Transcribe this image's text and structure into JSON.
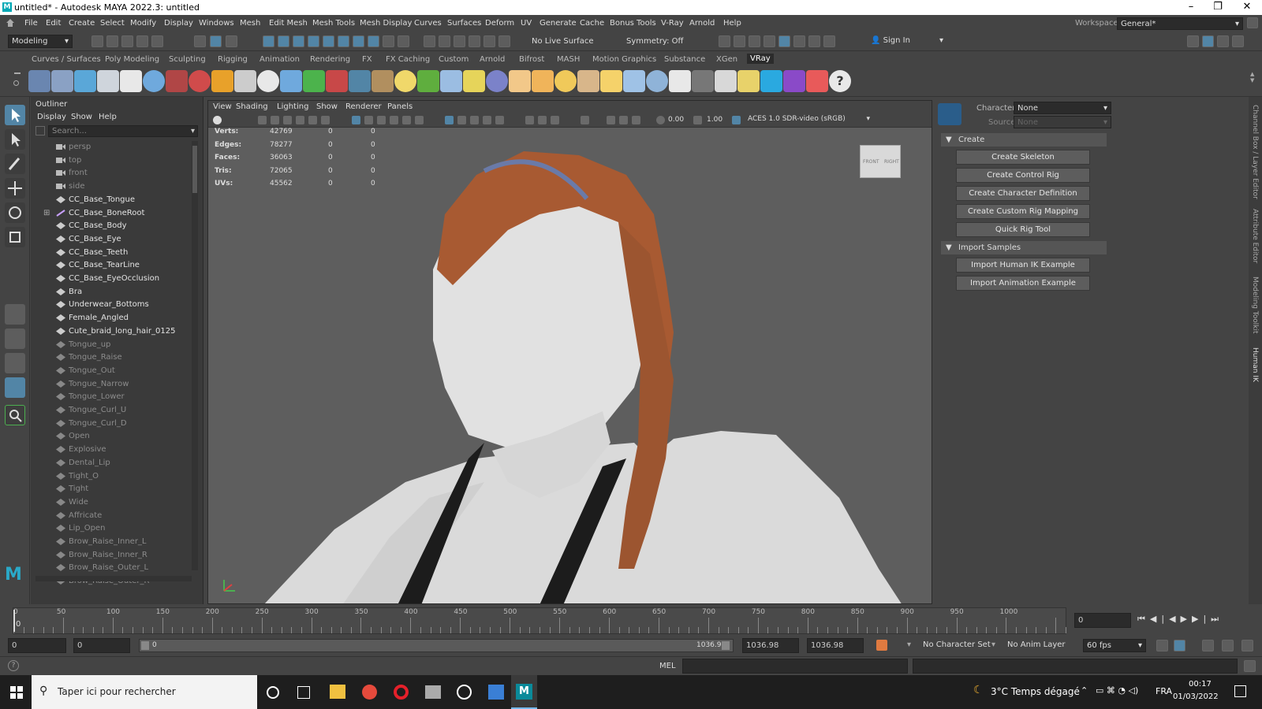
{
  "window": {
    "title": "untitled* - Autodesk MAYA 2022.3: untitled",
    "minimize": "–",
    "maximize": "❐",
    "close": "✕"
  },
  "menu": [
    "File",
    "Edit",
    "Create",
    "Select",
    "Modify",
    "Display",
    "Windows",
    "Mesh",
    "Edit Mesh",
    "Mesh Tools",
    "Mesh Display",
    "Curves",
    "Surfaces",
    "Deform",
    "UV",
    "Generate",
    "Cache",
    "Bonus Tools",
    "V-Ray",
    "Arnold",
    "Help"
  ],
  "workspace": {
    "label": "Workspace:",
    "value": "General*"
  },
  "statusline": {
    "mode": "Modeling",
    "live_surface": "No Live Surface",
    "symmetry": "Symmetry: Off",
    "sign_in": "Sign In"
  },
  "shelf_tabs": [
    "Curves / Surfaces",
    "Poly Modeling",
    "Sculpting",
    "Rigging",
    "Animation",
    "Rendering",
    "FX",
    "FX Caching",
    "Custom",
    "Arnold",
    "Bifrost",
    "MASH",
    "Motion Graphics",
    "Substance",
    "XGen",
    "VRay"
  ],
  "shelf_active": "VRay",
  "outliner": {
    "title": "Outliner",
    "menu": [
      "Display",
      "Show",
      "Help"
    ],
    "search_placeholder": "Search...",
    "items": [
      {
        "label": "persp",
        "type": "camera",
        "dim": true
      },
      {
        "label": "top",
        "type": "camera",
        "dim": true
      },
      {
        "label": "front",
        "type": "camera",
        "dim": true
      },
      {
        "label": "side",
        "type": "camera",
        "dim": true
      },
      {
        "label": "CC_Base_Tongue",
        "type": "mesh",
        "dim": false
      },
      {
        "label": "CC_Base_BoneRoot",
        "type": "joint",
        "dim": false,
        "expand": "⊞"
      },
      {
        "label": "CC_Base_Body",
        "type": "mesh",
        "dim": false
      },
      {
        "label": "CC_Base_Eye",
        "type": "mesh",
        "dim": false
      },
      {
        "label": "CC_Base_Teeth",
        "type": "mesh",
        "dim": false
      },
      {
        "label": "CC_Base_TearLine",
        "type": "mesh",
        "dim": false
      },
      {
        "label": "CC_Base_EyeOcclusion",
        "type": "mesh",
        "dim": false
      },
      {
        "label": "Bra",
        "type": "mesh",
        "dim": false
      },
      {
        "label": "Underwear_Bottoms",
        "type": "mesh",
        "dim": false
      },
      {
        "label": "Female_Angled",
        "type": "mesh",
        "dim": false
      },
      {
        "label": "Cute_braid_long_hair_0125",
        "type": "mesh",
        "dim": false
      },
      {
        "label": "Tongue_up",
        "type": "mesh",
        "dim": true
      },
      {
        "label": "Tongue_Raise",
        "type": "mesh",
        "dim": true
      },
      {
        "label": "Tongue_Out",
        "type": "mesh",
        "dim": true
      },
      {
        "label": "Tongue_Narrow",
        "type": "mesh",
        "dim": true
      },
      {
        "label": "Tongue_Lower",
        "type": "mesh",
        "dim": true
      },
      {
        "label": "Tongue_Curl_U",
        "type": "mesh",
        "dim": true
      },
      {
        "label": "Tongue_Curl_D",
        "type": "mesh",
        "dim": true
      },
      {
        "label": "Open",
        "type": "mesh",
        "dim": true
      },
      {
        "label": "Explosive",
        "type": "mesh",
        "dim": true
      },
      {
        "label": "Dental_Lip",
        "type": "mesh",
        "dim": true
      },
      {
        "label": "Tight_O",
        "type": "mesh",
        "dim": true
      },
      {
        "label": "Tight",
        "type": "mesh",
        "dim": true
      },
      {
        "label": "Wide",
        "type": "mesh",
        "dim": true
      },
      {
        "label": "Affricate",
        "type": "mesh",
        "dim": true
      },
      {
        "label": "Lip_Open",
        "type": "mesh",
        "dim": true
      },
      {
        "label": "Brow_Raise_Inner_L",
        "type": "mesh",
        "dim": true
      },
      {
        "label": "Brow_Raise_Inner_R",
        "type": "mesh",
        "dim": true
      },
      {
        "label": "Brow_Raise_Outer_L",
        "type": "mesh",
        "dim": true
      },
      {
        "label": "Brow_Raise_Outer_R",
        "type": "mesh",
        "dim": true
      }
    ]
  },
  "viewport": {
    "menu": [
      "View",
      "Shading",
      "Lighting",
      "Show",
      "Renderer",
      "Panels"
    ],
    "field_a": "0.00",
    "field_b": "1.00",
    "colorspace": "ACES 1.0 SDR-video (sRGB)",
    "hud": [
      {
        "k": "Verts:",
        "v1": "42769",
        "v2": "0",
        "v3": "0"
      },
      {
        "k": "Edges:",
        "v1": "78277",
        "v2": "0",
        "v3": "0"
      },
      {
        "k": "Faces:",
        "v1": "36063",
        "v2": "0",
        "v3": "0"
      },
      {
        "k": "Tris:",
        "v1": "72065",
        "v2": "0",
        "v3": "0"
      },
      {
        "k": "UVs:",
        "v1": "45562",
        "v2": "0",
        "v3": "0"
      }
    ],
    "viewcube": {
      "front": "FRONT",
      "right": "RIGHT"
    }
  },
  "hik": {
    "character_label": "Character:",
    "character_value": "None",
    "source_label": "Source:",
    "source_value": "None",
    "create_section": "Create",
    "create_buttons": [
      "Create Skeleton",
      "Create Control Rig",
      "Create Character Definition",
      "Create Custom Rig Mapping",
      "Quick Rig Tool"
    ],
    "import_section": "Import Samples",
    "import_buttons": [
      "Import Human IK Example",
      "Import Animation Example"
    ]
  },
  "side_tabs": [
    "Channel Box / Layer Editor",
    "Attribute Editor",
    "Modeling Toolkit",
    "Human IK"
  ],
  "timeline": {
    "ticks": [
      "0",
      "50",
      "100",
      "150",
      "200",
      "250",
      "300",
      "350",
      "400",
      "450",
      "500",
      "550",
      "600",
      "650",
      "700",
      "750",
      "800",
      "850",
      "900",
      "950",
      "1000"
    ],
    "current_frame_marker": "0",
    "current_frame": "0"
  },
  "range": {
    "start": "0",
    "anim_start": "0",
    "slider_start": "0",
    "slider_end": "1036.98",
    "anim_end": "1036.98",
    "end": "1036.98",
    "char_set": "No Character Set",
    "anim_layer": "No Anim Layer",
    "fps": "60 fps"
  },
  "cmdline": {
    "lang": "MEL",
    "help": "?"
  },
  "taskbar": {
    "search": "Taper ici pour rechercher",
    "weather": "3°C  Temps dégagé",
    "lang": "FRA",
    "time": "00:17",
    "date": "01/03/2022"
  },
  "colors": {
    "accent": "#5285a6",
    "hair": "#a85a32",
    "skin": "#d9d9d9",
    "hud_bg": "#5e5e5e"
  }
}
